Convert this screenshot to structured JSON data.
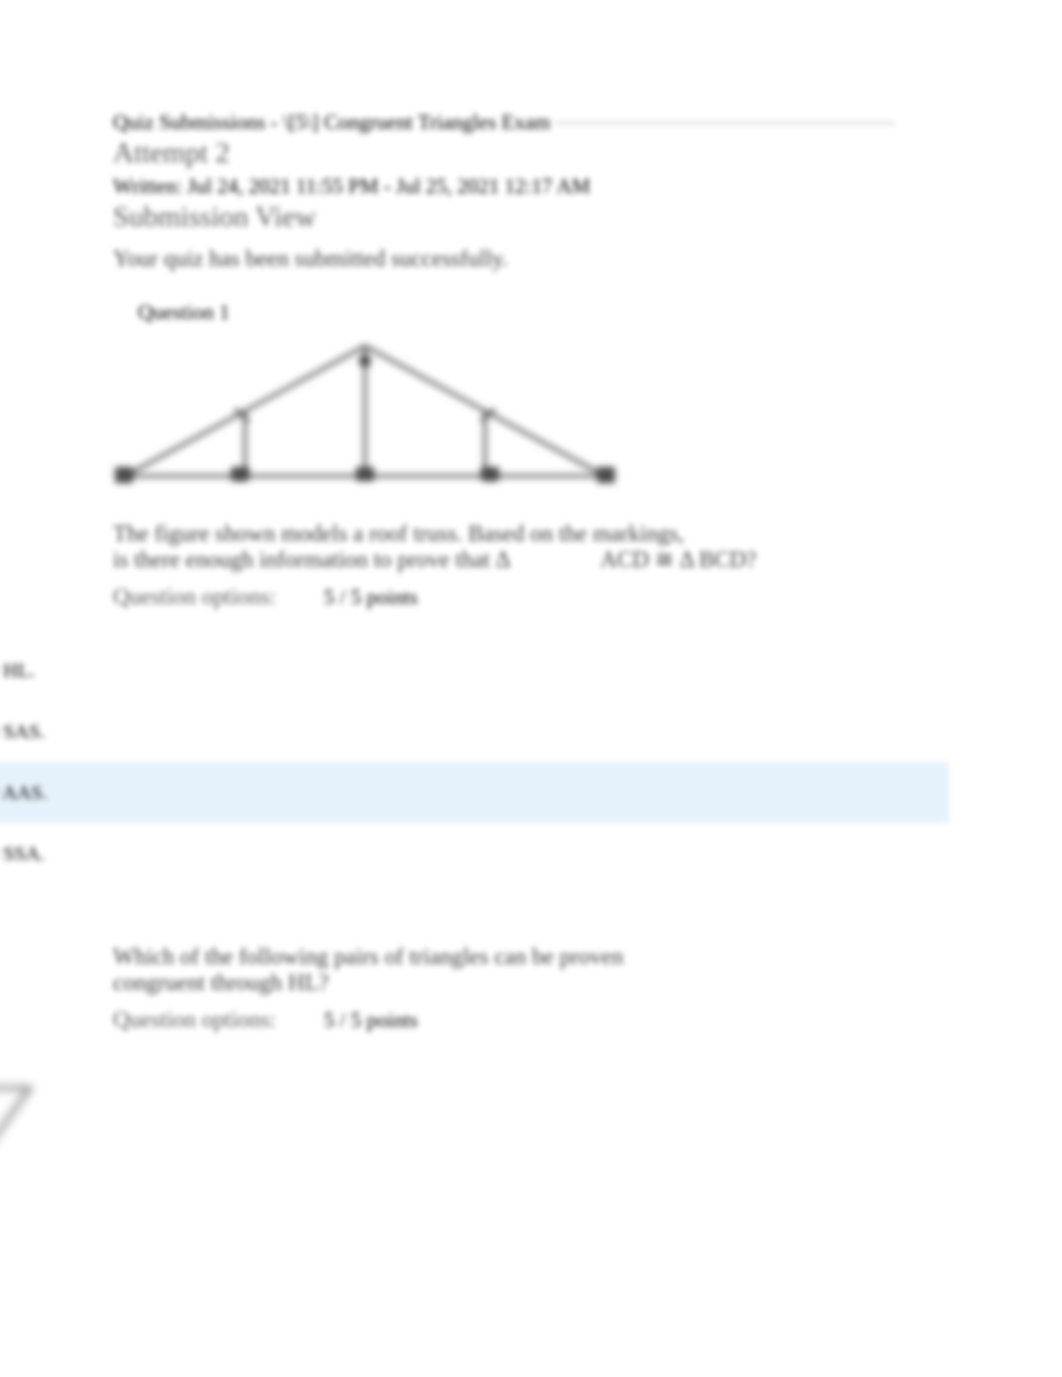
{
  "header": {
    "quiz_title": "Quiz Submissions - \\[5\\] Congruent Triangles Exam",
    "attempt": "Attempt 2",
    "written": "Written: Jul 24, 2021 11:55 PM - Jul 25, 2021 12:17 AM",
    "submission_view": "Submission View",
    "success": "Your quiz has been submitted successfully."
  },
  "question1": {
    "label": "Question 1",
    "text_line1": "The figure shown models a roof truss. Based on the markings,",
    "text_line2_a": "is there enough information to prove that Δ",
    "text_line2_b": "ACD ≅ Δ BCD?",
    "options_label": "Question options:",
    "points": "5 / 5 points",
    "answers": [
      {
        "text": ") ≅ ΔBCD by HL.",
        "highlighted": false
      },
      {
        "text": ") ≅ ΔBCD by SAS.",
        "highlighted": false
      },
      {
        "text": ") ≅ ΔBCD by AAS.",
        "highlighted": true
      },
      {
        "text": ") ≅ ΔBCD by SSA.",
        "highlighted": false
      }
    ]
  },
  "question2": {
    "text": "Which of the following pairs of triangles can be proven congruent through HL?",
    "options_label": "Question options:",
    "points": "5 / 5 points"
  }
}
